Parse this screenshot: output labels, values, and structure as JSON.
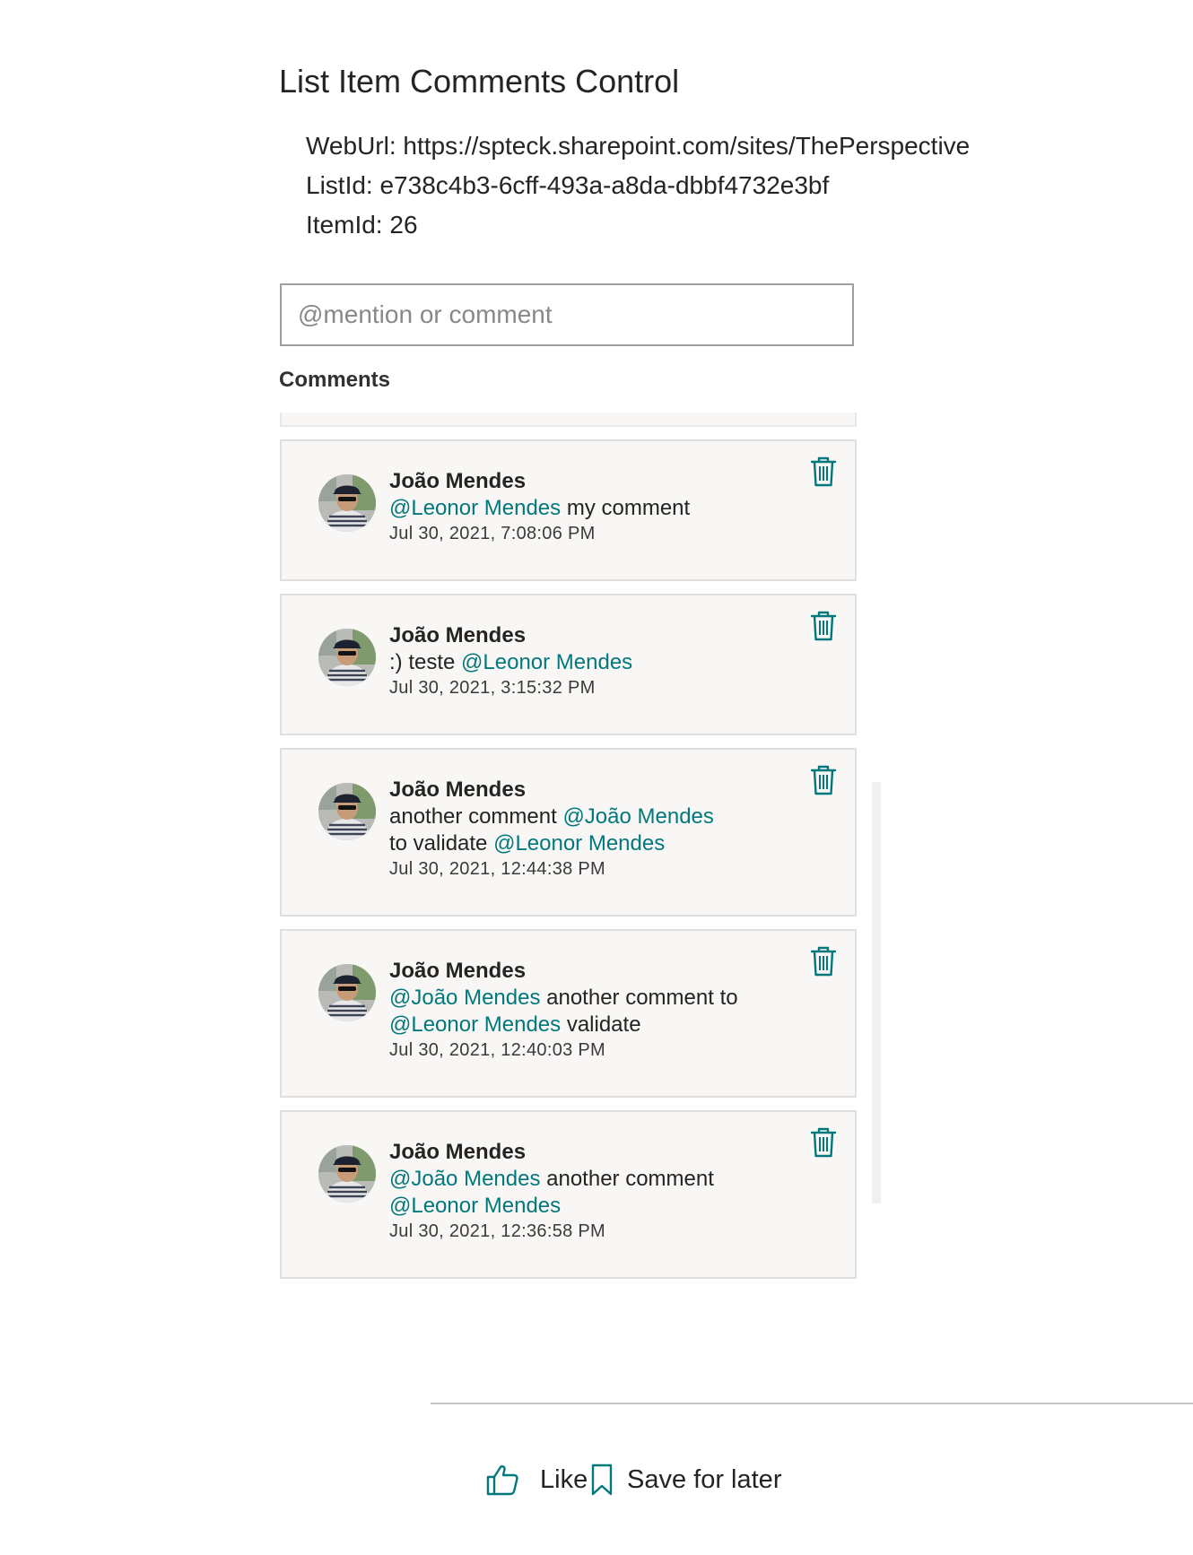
{
  "title": "List Item Comments Control",
  "properties": {
    "web_url": "WebUrl: https://spteck.sharepoint.com/sites/ThePerspective",
    "list_id": "ListId: e738c4b3-6cff-493a-a8da-dbbf4732e3bf",
    "item_id": "ItemId: 26"
  },
  "input": {
    "placeholder": "@mention or comment",
    "value": ""
  },
  "comments_label": "Comments",
  "comments": [
    {
      "author": "João Mendes",
      "lines": [
        [
          {
            "mention": true,
            "text": "@Leonor Mendes"
          },
          {
            "mention": false,
            "text": " my comment"
          }
        ]
      ],
      "date": "Jul 30, 2021, 7:08:06 PM"
    },
    {
      "author": "João Mendes",
      "lines": [
        [
          {
            "mention": false,
            "text": ":) teste "
          },
          {
            "mention": true,
            "text": "@Leonor Mendes"
          }
        ]
      ],
      "date": "Jul 30, 2021, 3:15:32 PM"
    },
    {
      "author": "João Mendes",
      "lines": [
        [
          {
            "mention": false,
            "text": "another comment "
          },
          {
            "mention": true,
            "text": "@João Mendes"
          }
        ],
        [
          {
            "mention": false,
            "text": "to validate "
          },
          {
            "mention": true,
            "text": "@Leonor Mendes"
          }
        ]
      ],
      "date": "Jul 30, 2021, 12:44:38 PM"
    },
    {
      "author": "João Mendes",
      "lines": [
        [
          {
            "mention": true,
            "text": "@João Mendes"
          },
          {
            "mention": false,
            "text": " another comment to"
          }
        ],
        [
          {
            "mention": true,
            "text": "@Leonor Mendes"
          },
          {
            "mention": false,
            "text": " validate"
          }
        ]
      ],
      "date": "Jul 30, 2021, 12:40:03 PM"
    },
    {
      "author": "João Mendes",
      "lines": [
        [
          {
            "mention": true,
            "text": "@João Mendes"
          },
          {
            "mention": false,
            "text": " another comment"
          }
        ],
        [
          {
            "mention": true,
            "text": "@Leonor Mendes"
          }
        ]
      ],
      "date": "Jul 30, 2021, 12:36:58 PM"
    }
  ],
  "footer": {
    "like_label": "Like",
    "save_label": "Save for later"
  },
  "colors": {
    "accent": "#03787c",
    "card_background": "#f8f7f5",
    "text": "#252423"
  },
  "icons": {
    "delete": "trash-icon",
    "like": "thumbs-up-icon",
    "save": "bookmark-icon"
  }
}
